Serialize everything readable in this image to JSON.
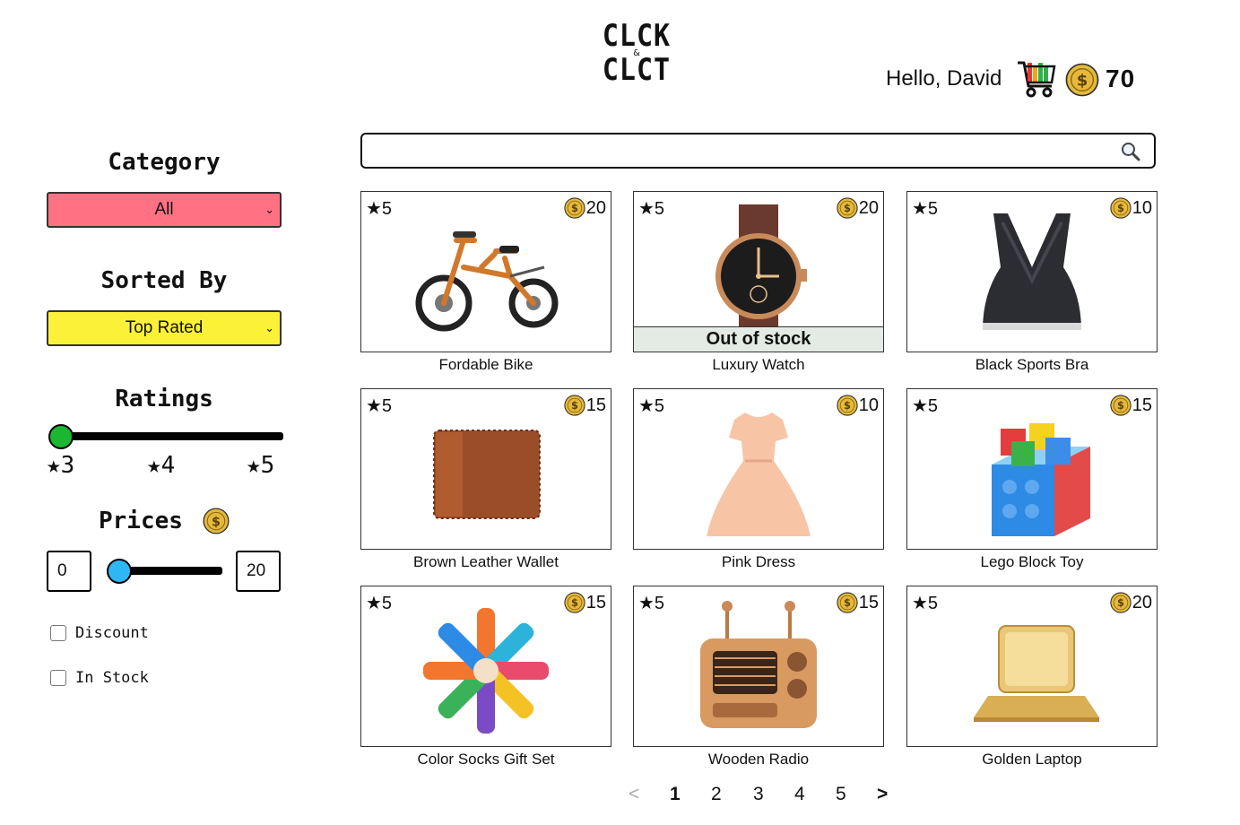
{
  "header": {
    "logo_line1": "CLCK",
    "logo_amp": "&",
    "logo_line2": "CLCT",
    "greeting": "Hello, David",
    "balance": "70"
  },
  "sidebar": {
    "category_heading": "Category",
    "category_value": "All",
    "sort_heading": "Sorted By",
    "sort_value": "Top Rated",
    "ratings_heading": "Ratings",
    "rating_labels": [
      "★3",
      "★4",
      "★5"
    ],
    "rating_selected": 3,
    "prices_heading": "Prices",
    "price_min": "0",
    "price_max": "20",
    "discount_label": "Discount",
    "instock_label": "In Stock"
  },
  "search": {
    "value": ""
  },
  "products": [
    {
      "rating": "★5",
      "price": "20",
      "name": "Fordable Bike",
      "image": "bike",
      "out_of_stock": ""
    },
    {
      "rating": "★5",
      "price": "20",
      "name": "Luxury Watch",
      "image": "watch",
      "out_of_stock": "Out of stock"
    },
    {
      "rating": "★5",
      "price": "10",
      "name": "Black Sports Bra",
      "image": "sports-bra",
      "out_of_stock": ""
    },
    {
      "rating": "★5",
      "price": "15",
      "name": "Brown Leather Wallet",
      "image": "wallet",
      "out_of_stock": ""
    },
    {
      "rating": "★5",
      "price": "10",
      "name": "Pink Dress",
      "image": "dress",
      "out_of_stock": ""
    },
    {
      "rating": "★5",
      "price": "15",
      "name": "Lego Block Toy",
      "image": "lego",
      "out_of_stock": ""
    },
    {
      "rating": "★5",
      "price": "15",
      "name": "Color Socks Gift Set",
      "image": "socks",
      "out_of_stock": ""
    },
    {
      "rating": "★5",
      "price": "15",
      "name": "Wooden Radio",
      "image": "radio",
      "out_of_stock": ""
    },
    {
      "rating": "★5",
      "price": "20",
      "name": "Golden Laptop",
      "image": "laptop",
      "out_of_stock": ""
    }
  ],
  "pagination": {
    "prev": "<",
    "pages": [
      "1",
      "2",
      "3",
      "4",
      "5"
    ],
    "current": "1",
    "next": ">"
  },
  "colors": {
    "category_select": "#ff7183",
    "sort_select": "#fbf137",
    "rating_knob": "#1bb731",
    "price_knob": "#2fb7f5",
    "coin": "#e6b93a"
  }
}
